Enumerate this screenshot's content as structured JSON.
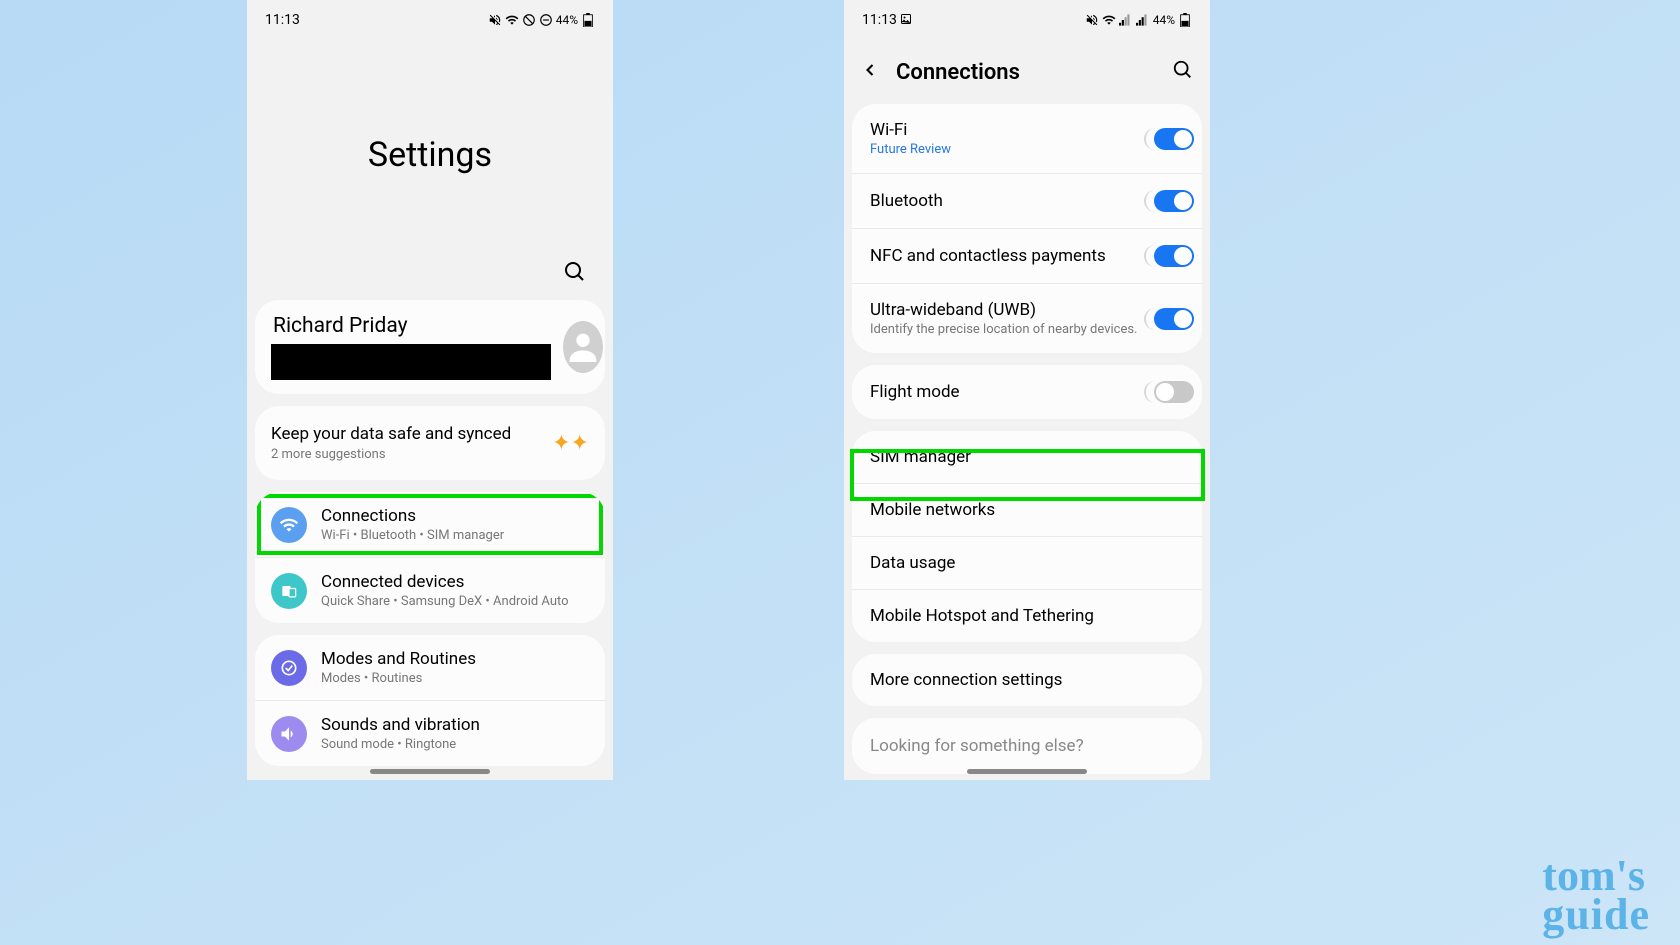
{
  "status": {
    "time": "11:13",
    "battery": "44%"
  },
  "screen1": {
    "title": "Settings",
    "profile_name": "Richard Priday",
    "suggestion_title": "Keep your data safe and synced",
    "suggestion_sub": "2 more suggestions",
    "items": [
      {
        "title": "Connections",
        "sub": "Wi-Fi  •  Bluetooth  •  SIM manager"
      },
      {
        "title": "Connected devices",
        "sub": "Quick Share  •  Samsung DeX  •  Android Auto"
      },
      {
        "title": "Modes and Routines",
        "sub": "Modes  •  Routines"
      },
      {
        "title": "Sounds and vibration",
        "sub": "Sound mode  •  Ringtone"
      }
    ]
  },
  "screen2": {
    "title": "Connections",
    "group1": [
      {
        "label": "Wi-Fi",
        "sub": "Future Review",
        "toggle": true
      },
      {
        "label": "Bluetooth",
        "sub": "",
        "toggle": true
      },
      {
        "label": "NFC and contactless payments",
        "sub": "",
        "toggle": true
      },
      {
        "label": "Ultra-wideband (UWB)",
        "sub": "Identify the precise location of nearby devices.",
        "toggle": true
      }
    ],
    "group2": [
      {
        "label": "Flight mode",
        "toggle": false
      }
    ],
    "group3": [
      {
        "label": "SIM manager"
      },
      {
        "label": "Mobile networks"
      },
      {
        "label": "Data usage"
      },
      {
        "label": "Mobile Hotspot and Tethering"
      }
    ],
    "group4": [
      {
        "label": "More connection settings"
      }
    ],
    "footer": "Looking for something else?"
  },
  "watermark": {
    "line1": "tom's",
    "line2": "guide"
  }
}
